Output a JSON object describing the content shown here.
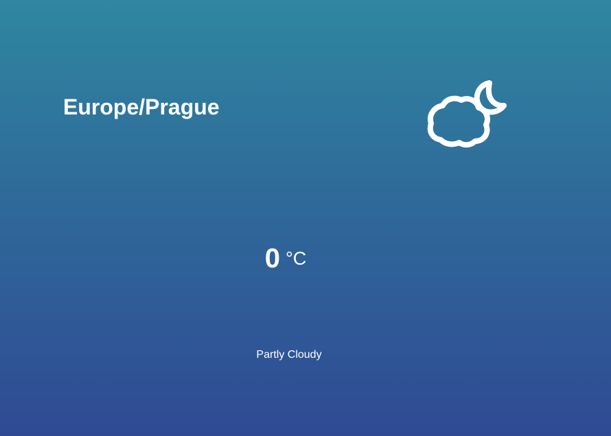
{
  "location": {
    "timezone": "Europe/Prague"
  },
  "weather": {
    "icon": "partly-cloudy-night-icon",
    "temperature": "0",
    "unit": "°C",
    "description": "Partly Cloudy"
  },
  "colors": {
    "background_top": "#2f87a0",
    "background_bottom": "#2f4a93",
    "text": "#ffffff"
  }
}
